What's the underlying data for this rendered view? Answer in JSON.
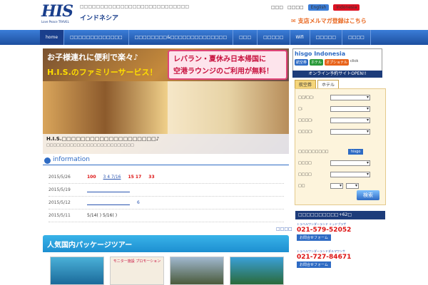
{
  "header": {
    "logo_text": "HIS",
    "logo_tagline": "Love Peace TRAVEL",
    "site_name": "インドネシア",
    "tagline": "□□□□□□□□□□□□□□□□□□□□□□□□□□□",
    "links": [
      "□□□",
      "□□□□"
    ],
    "lang_en": "English",
    "lang_id": "Indonesia",
    "mailmag": "支店メルマガ登録はこちら"
  },
  "nav": {
    "items": [
      "home",
      "□□□□□□□□□□□□□",
      "□□□□□□□□&□□□□□□□□□□□□□□",
      "□□□",
      "□□□□□",
      "Wifi",
      "□□□□□",
      "□□□□"
    ]
  },
  "hero": {
    "line1": "お子様連れに便利で楽々♪",
    "line2": "H.I.S.のファミリーサービス！",
    "pink1": "レバラン・夏休み日本帰国に",
    "pink2": "空港ラウンジのご利用が無料！",
    "caption1": "H.I.S.□□□□□□□□□□□□□□□□□□□□♪",
    "caption2": "□□□□□□□□□□□□□□□□□□□□□□□□□□"
  },
  "info": {
    "heading": "information",
    "rows": [
      {
        "date": "2015/5/26",
        "text1": "100",
        "text2": "3 4 7/16",
        "text3": "15 17",
        "text4": "33"
      },
      {
        "date": "2015/5/19",
        "text1": ""
      },
      {
        "date": "2015/5/12",
        "text1": "6"
      },
      {
        "date": "2015/5/11",
        "text1": "5/14( ) 5/16( )"
      }
    ],
    "more": "□□□□"
  },
  "popular": {
    "heading": "人気国内パッケージツアー",
    "thumb2_label": "モニター施設 プロモーション"
  },
  "hisgo": {
    "title": "hisgo Indonesia",
    "pill1": "航空券",
    "pill2": "ホテル",
    "pill3": "オプショナル",
    "click": "click",
    "open": "オンライン予約サイトOPEN!!"
  },
  "search": {
    "tab_air": "航空券",
    "tab_hotel": "ホテル",
    "rows": [
      {
        "label": "□□/□□:"
      },
      {
        "label": "□:"
      },
      {
        "label": "□□□□:"
      },
      {
        "label": "□□□□:"
      },
      {
        "label": "□□□□□□□□□"
      },
      {
        "label": "□□□□"
      },
      {
        "label": "□□□□"
      },
      {
        "label": "□□"
      }
    ],
    "button": "検索",
    "hisgo_label": "hisgo"
  },
  "contact": {
    "head": "□□□□□□□□□□+62□",
    "items": [
      {
        "name": "トラベルワンダーランド ミッドプラザ",
        "number": "021-579-52052",
        "btn": "お問合せフォーム"
      },
      {
        "name": "トラベルワンダーランドダルマワンサ",
        "number": "021-727-84671",
        "btn": "お問合せフォーム"
      }
    ]
  },
  "colors": {
    "brand": "#1a3f8c",
    "accent": "#e8641b",
    "alert": "#d11111"
  }
}
